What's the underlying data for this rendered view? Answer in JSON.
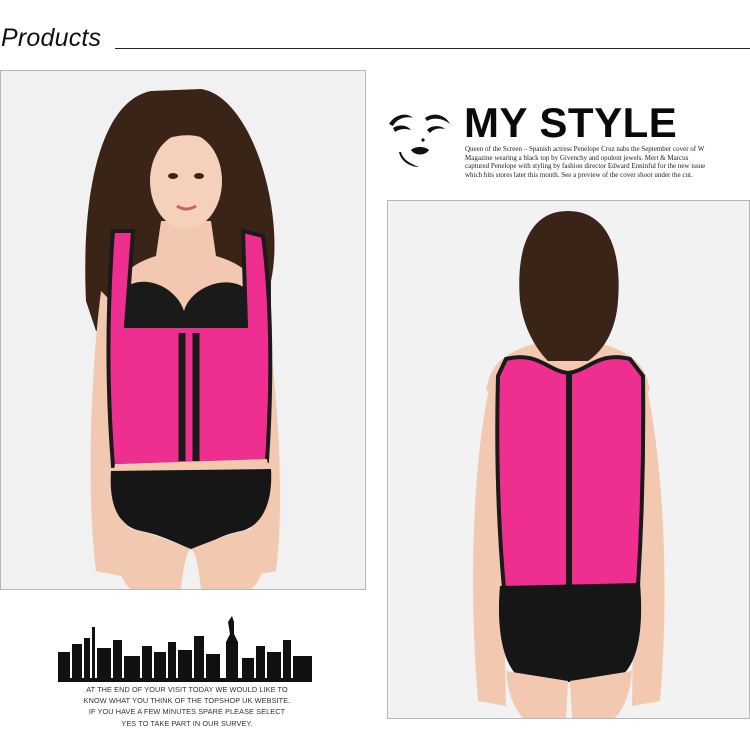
{
  "header": {
    "title": "Products"
  },
  "banner": {
    "title": "MY STYLE",
    "body": "Queen of the Screen – Spanish actress Penelope Cruz nabs the September cover of W Magazine wearing a black top by Givenchy and opulent jewels. Mert & Marcus captured Penelope with styling by fashion director Edward Enninful for the new issue which hits stores later this month. See a preview of the cover shoot under the cut."
  },
  "footer": {
    "text": "AT THE END OF YOUR VISIT TODAY WE WOULD LIKE TO KNOW WHAT YOU THINK OF THE TOPSHOP UK WEBSITE. IF YOU HAVE A FEW MINUTES SPARE PLEASE SELECT YES TO TAKE PART IN OUR SURVEY."
  },
  "colors": {
    "vest": "#ee2f8f",
    "trim": "#1a1a1a",
    "skin": "#f2c9b0",
    "hair": "#3a2418"
  }
}
